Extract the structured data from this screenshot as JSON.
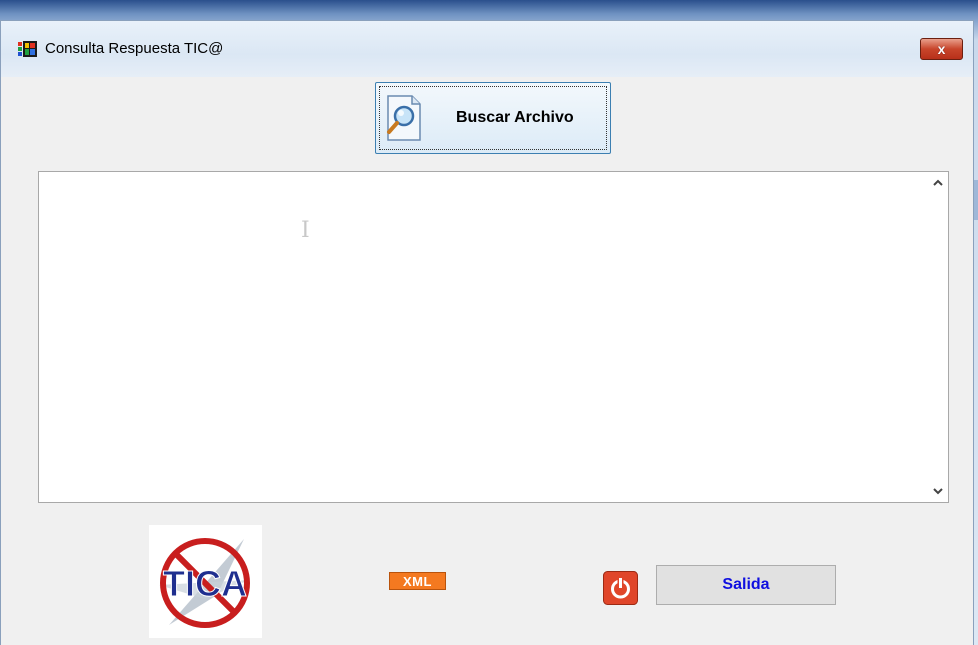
{
  "window": {
    "title": "Consulta Respuesta TIC@",
    "close_glyph": "x"
  },
  "toolbar": {
    "search_label": "Buscar Archivo",
    "search_icon": "document-search-icon"
  },
  "output": {
    "value": ""
  },
  "footer": {
    "logo_text": "TICA",
    "xml_badge": "XML",
    "exit_label": "Salida",
    "exit_icon": "power-icon"
  },
  "colors": {
    "accent_blue": "#1010e0",
    "xml_orange": "#f47920",
    "close_red": "#c8452b",
    "power_red": "#e0462a"
  }
}
